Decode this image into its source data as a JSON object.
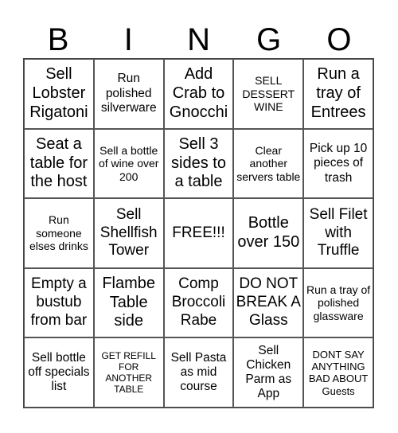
{
  "title_letters": [
    "B",
    "I",
    "N",
    "G",
    "O"
  ],
  "cells": [
    {
      "text": "Sell Lobster Rigatoni"
    },
    {
      "text": "Run polished silverware"
    },
    {
      "text": "Add Crab to Gnocchi"
    },
    {
      "text": "SELL DESSERT WINE"
    },
    {
      "text": "Run a tray of Entrees"
    },
    {
      "text": "Seat a table for the host"
    },
    {
      "text": "Sell a bottle of wine over 200"
    },
    {
      "text": "Sell 3 sides to a table"
    },
    {
      "text": "Clear another servers table"
    },
    {
      "text": "Pick up 10 pieces of trash"
    },
    {
      "text": "Run someone elses drinks"
    },
    {
      "text": "Sell Shellfish Tower"
    },
    {
      "text": "FREE!!!"
    },
    {
      "text": "Bottle over 150"
    },
    {
      "text": "Sell Filet with Truffle"
    },
    {
      "text": "Empty a bustub from bar"
    },
    {
      "text": "Flambe Table side"
    },
    {
      "text": "Comp Broccoli Rabe"
    },
    {
      "text": "DO NOT BREAK A Glass"
    },
    {
      "text": "Run a tray of polished glassware"
    },
    {
      "text": "Sell bottle off specials list"
    },
    {
      "text": "GET REFILL FOR ANOTHER TABLE"
    },
    {
      "text": "Sell Pasta as mid course"
    },
    {
      "text": "Sell Chicken Parm as App"
    },
    {
      "text": "DONT SAY ANYTHING BAD ABOUT Guests"
    }
  ]
}
